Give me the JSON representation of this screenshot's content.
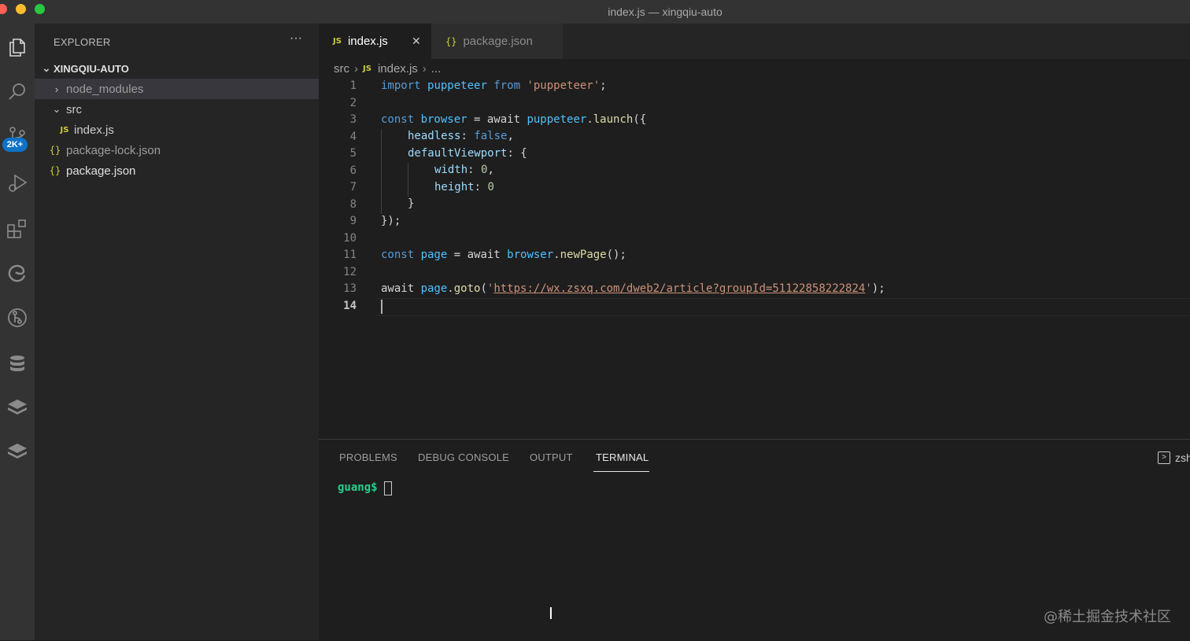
{
  "window": {
    "title": "index.js — xingqiu-auto"
  },
  "activity_bar": {
    "icons": [
      "files-icon",
      "search-icon",
      "source-control-icon",
      "run-debug-icon",
      "extensions-icon",
      "edge-icon",
      "gitlens-icon",
      "database-icon",
      "stack-icon",
      "layers-icon"
    ],
    "scm_badge": "2K+"
  },
  "sidebar": {
    "header": "EXPLORER",
    "more": "···",
    "root": "XINGQIU-AUTO",
    "items": [
      {
        "label": "node_modules",
        "type": "folder",
        "expanded": false
      },
      {
        "label": "src",
        "type": "folder",
        "expanded": true
      },
      {
        "label": "index.js",
        "type": "js"
      },
      {
        "label": "package-lock.json",
        "type": "json"
      },
      {
        "label": "package.json",
        "type": "json"
      }
    ]
  },
  "tabs": [
    {
      "label": "index.js",
      "icon": "JS",
      "active": true,
      "close": "✕"
    },
    {
      "label": "package.json",
      "icon": "{}",
      "active": false
    }
  ],
  "breadcrumb": {
    "folder": "src",
    "file": "index.js",
    "rest": "..."
  },
  "editor": {
    "line_numbers": [
      "1",
      "2",
      "3",
      "4",
      "5",
      "6",
      "7",
      "8",
      "9",
      "10",
      "11",
      "12",
      "13",
      "14"
    ],
    "current_line": "14",
    "code": {
      "l1": {
        "a": "import ",
        "b": "puppeteer",
        "c": " from ",
        "d": "'puppeteer'",
        "e": ";"
      },
      "l3": {
        "a": "const ",
        "b": "browser",
        "c": " = await ",
        "d": "puppeteer",
        "e": ".",
        "f": "launch",
        "g": "({"
      },
      "l4": {
        "a": "headless",
        "b": ": ",
        "c": "false",
        "d": ","
      },
      "l5": {
        "a": "defaultViewport",
        "b": ": {"
      },
      "l6": {
        "a": "width",
        "b": ": ",
        "c": "0",
        "d": ","
      },
      "l7": {
        "a": "height",
        "b": ": ",
        "c": "0"
      },
      "l8": {
        "a": "}"
      },
      "l9": {
        "a": "});"
      },
      "l11": {
        "a": "const ",
        "b": "page",
        "c": " = await ",
        "d": "browser",
        "e": ".",
        "f": "newPage",
        "g": "();"
      },
      "l13": {
        "a": "await ",
        "b": "page",
        "c": ".",
        "d": "goto",
        "e": "(",
        "f": "'",
        "g": "https://wx.zsxq.com/dweb2/article?groupId=51122858222824",
        "h": "'",
        "i": ");"
      }
    }
  },
  "panel": {
    "tabs": [
      "PROBLEMS",
      "DEBUG CONSOLE",
      "OUTPUT",
      "TERMINAL"
    ],
    "active_tab": "TERMINAL",
    "shell": "zsh",
    "prompt": "guang$"
  },
  "watermark": "@稀土掘金技术社区"
}
